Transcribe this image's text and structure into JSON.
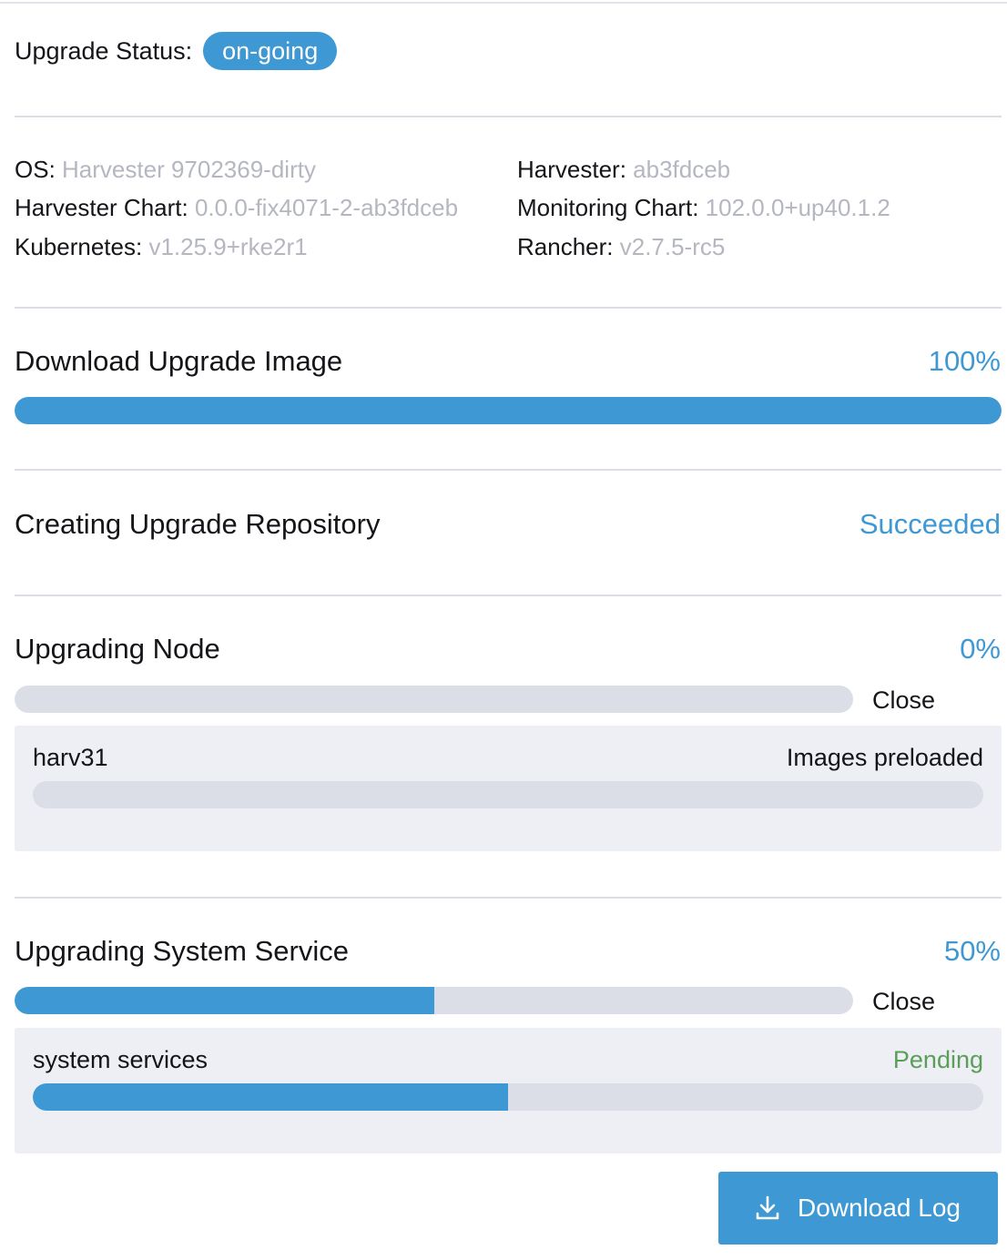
{
  "upgrade_status": {
    "label": "Upgrade Status:",
    "badge": "on-going"
  },
  "versions": {
    "os": {
      "label": "OS:",
      "value": "Harvester 9702369-dirty"
    },
    "harvester": {
      "label": "Harvester:",
      "value": "ab3fdceb"
    },
    "harvester_chart": {
      "label": "Harvester Chart:",
      "value": "0.0.0-fix4071-2-ab3fdceb"
    },
    "monitoring_chart": {
      "label": "Monitoring Chart:",
      "value": "102.0.0+up40.1.2"
    },
    "kubernetes": {
      "label": "Kubernetes:",
      "value": "v1.25.9+rke2r1"
    },
    "rancher": {
      "label": "Rancher:",
      "value": "v2.7.5-rc5"
    }
  },
  "download_image": {
    "title": "Download Upgrade Image",
    "value": "100%",
    "progress": 1.0
  },
  "repository": {
    "title": "Creating Upgrade Repository",
    "value": "Succeeded"
  },
  "upgrading_node": {
    "title": "Upgrading Node",
    "value": "0%",
    "progress": 0,
    "close_label": "Close",
    "items": [
      {
        "name": "harv31",
        "status": "Images preloaded",
        "progress": 0
      }
    ]
  },
  "system_service": {
    "title": "Upgrading System Service",
    "value": "50%",
    "progress": 0.5,
    "close_label": "Close",
    "items": [
      {
        "name": "system services",
        "status": "Pending",
        "progress": 0.5
      }
    ]
  },
  "download_log": {
    "label": "Download Log",
    "icon": "download-icon"
  },
  "colors": {
    "accent": "#3d98d3",
    "muted": "#b5b7c0",
    "track": "#dcdee7",
    "pending": "#5a9e5a"
  }
}
